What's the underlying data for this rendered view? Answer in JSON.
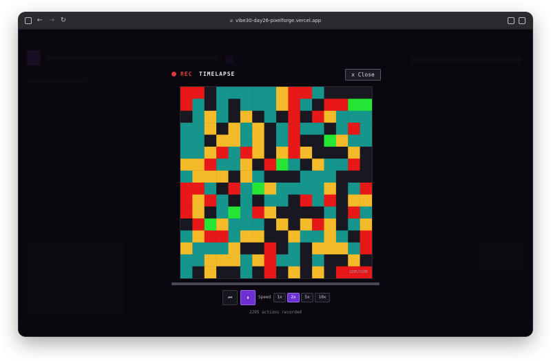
{
  "browser": {
    "url": "vibe30-day26-pixelforge.vercel.app",
    "icons": [
      "sidebar-toggle-icon",
      "back-arrow-icon",
      "forward-arrow-icon",
      "reload-icon",
      "link-icon",
      "reader-icon",
      "tabs-icon"
    ]
  },
  "modal": {
    "rec_label": "REC",
    "title": "TIMELAPSE",
    "close_label": "x Close",
    "frame_counter": "2295/2295",
    "progress": 1.0
  },
  "controls": {
    "restart_label": "⏮",
    "pause_label": "⏸",
    "speed_label": "Speed",
    "speeds": [
      "1x",
      "2x",
      "5x",
      "10x"
    ],
    "active_speed": "2x",
    "actions_text": "2295 actions recorded"
  },
  "colors": {
    "teal": "#15958c",
    "red": "#e61818",
    "yellow": "#f3bb2a",
    "dark": "#191820",
    "green": "#25e634",
    "accent": "#6c2fd1"
  },
  "pixel_grid": {
    "size": 16,
    "legend": {
      "T": "teal",
      "R": "red",
      "Y": "yellow",
      "D": "dark",
      "G": "green"
    },
    "rows": [
      "RRDTTTTTYRRTDDDD",
      "RTDTDTTTYRTDRRGG",
      "DTYTDYDTDRDRYTTT",
      "TTYDYTYDTRTTDTRT",
      "TTDYYTYDTRDDGYTT",
      "TTYRTRYDYRYDDDYD",
      "YYRTTYDRGTDYTTRD",
      "TYYYDYTDDDTTTDDD",
      "RRTDRTGYTTTTYDTR",
      "RYRTDTDTTDRTRDYY",
      "RYDTGTRYDDDDTDRT",
      "DRGYTTTDYDYRYDTY",
      "TYRRTYYDDYTTYTDR",
      "YTTTYDDRDTDYYYTR",
      "TTYYYTYRTTDTDDYD",
      "TDYDDTDRDYDYDRRR"
    ]
  }
}
